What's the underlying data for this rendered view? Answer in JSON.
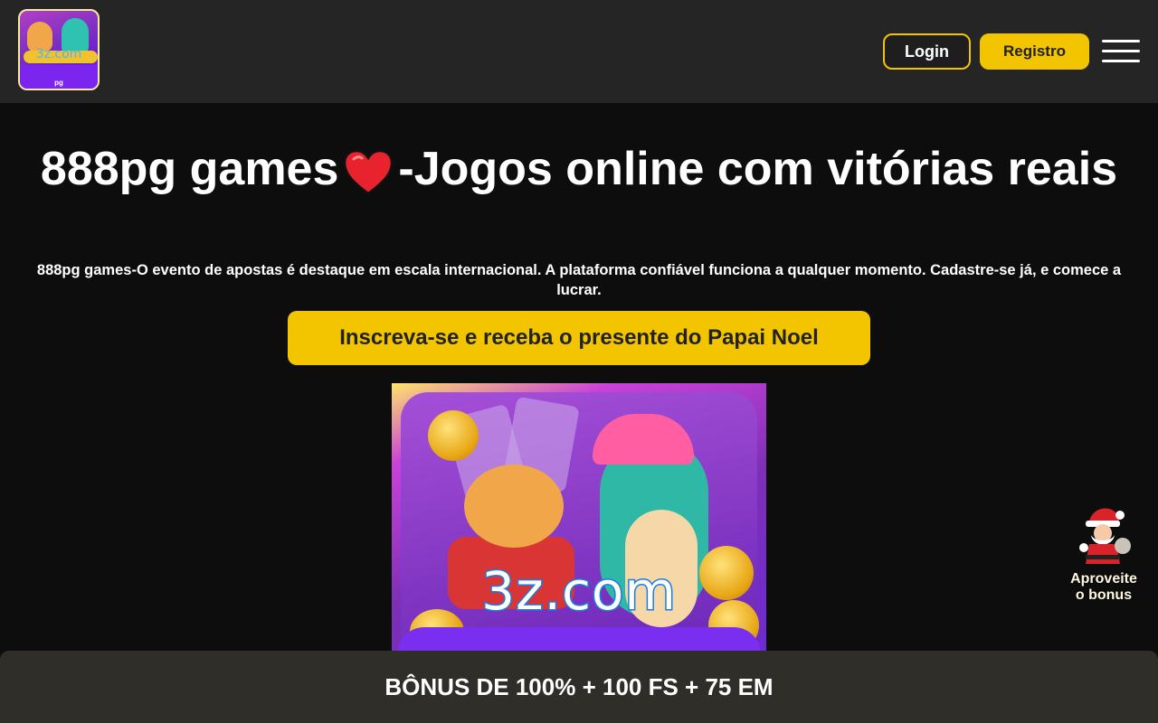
{
  "header": {
    "logo": {
      "name": "logo-3z",
      "text": "3z.com",
      "subtext": "pg"
    },
    "login_label": "Login",
    "register_label": "Registro",
    "menu_icon": "hamburger-icon"
  },
  "hero": {
    "title_part1": "888pg games",
    "title_icon": "heart-icon",
    "title_part2": "-Jogos online com vitórias reais",
    "description": "888pg games-O evento de apostas é destaque em escala internacional. A plataforma confiável funciona a qualquer momento. Cadastre-se já, e comece a lucrar.",
    "cta_label": "Inscreva-se e receba o presente do Papai Noel"
  },
  "banner": {
    "brand_text": "3z.com"
  },
  "floating_bonus": {
    "icon": "santa-icon",
    "label_line1": "Aproveite",
    "label_line2": "o bonus"
  },
  "bottom_bar": {
    "text": "BÔNUS DE 100% + 100 FS + 75 EM"
  },
  "colors": {
    "accent": "#f2c500",
    "header_bg": "#252525",
    "page_bg": "#0d0d0d",
    "bottom_bar_bg": "#302e28",
    "heart": "#e8232e"
  }
}
